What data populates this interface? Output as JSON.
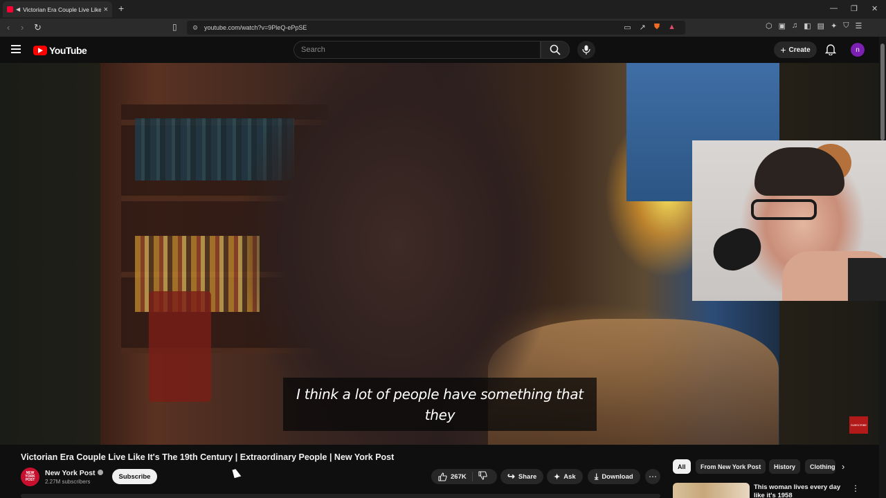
{
  "browser": {
    "tab_title": "Victorian Era Couple Live Like It's The 19th Century | Extraordinary People | New York Post",
    "url": "youtube.com/watch?v=9PleQ-ePpSE"
  },
  "youtube": {
    "logo_text": "YouTube",
    "search_placeholder": "Search",
    "create_label": "Create",
    "avatar_letter": "n"
  },
  "video": {
    "subtitle_line1": "I think a lot of people have something that",
    "subtitle_line2": "they",
    "watermark": "SUBSCRIBE"
  },
  "meta": {
    "title": "Victorian Era Couple Live Like It's The 19th Century | Extraordinary People | New York Post",
    "channel_name": "New York Post",
    "channel_avatar_text": "NEW YORK POST",
    "subscribers": "2.27M subscribers",
    "subscribe_label": "Subscribe",
    "likes": "267K",
    "share_label": "Share",
    "ask_label": "Ask",
    "download_label": "Download"
  },
  "chips": [
    "All",
    "From New York Post",
    "History",
    "Clothing"
  ],
  "recommendation": {
    "title": "This woman lives every day like it's 1958"
  }
}
